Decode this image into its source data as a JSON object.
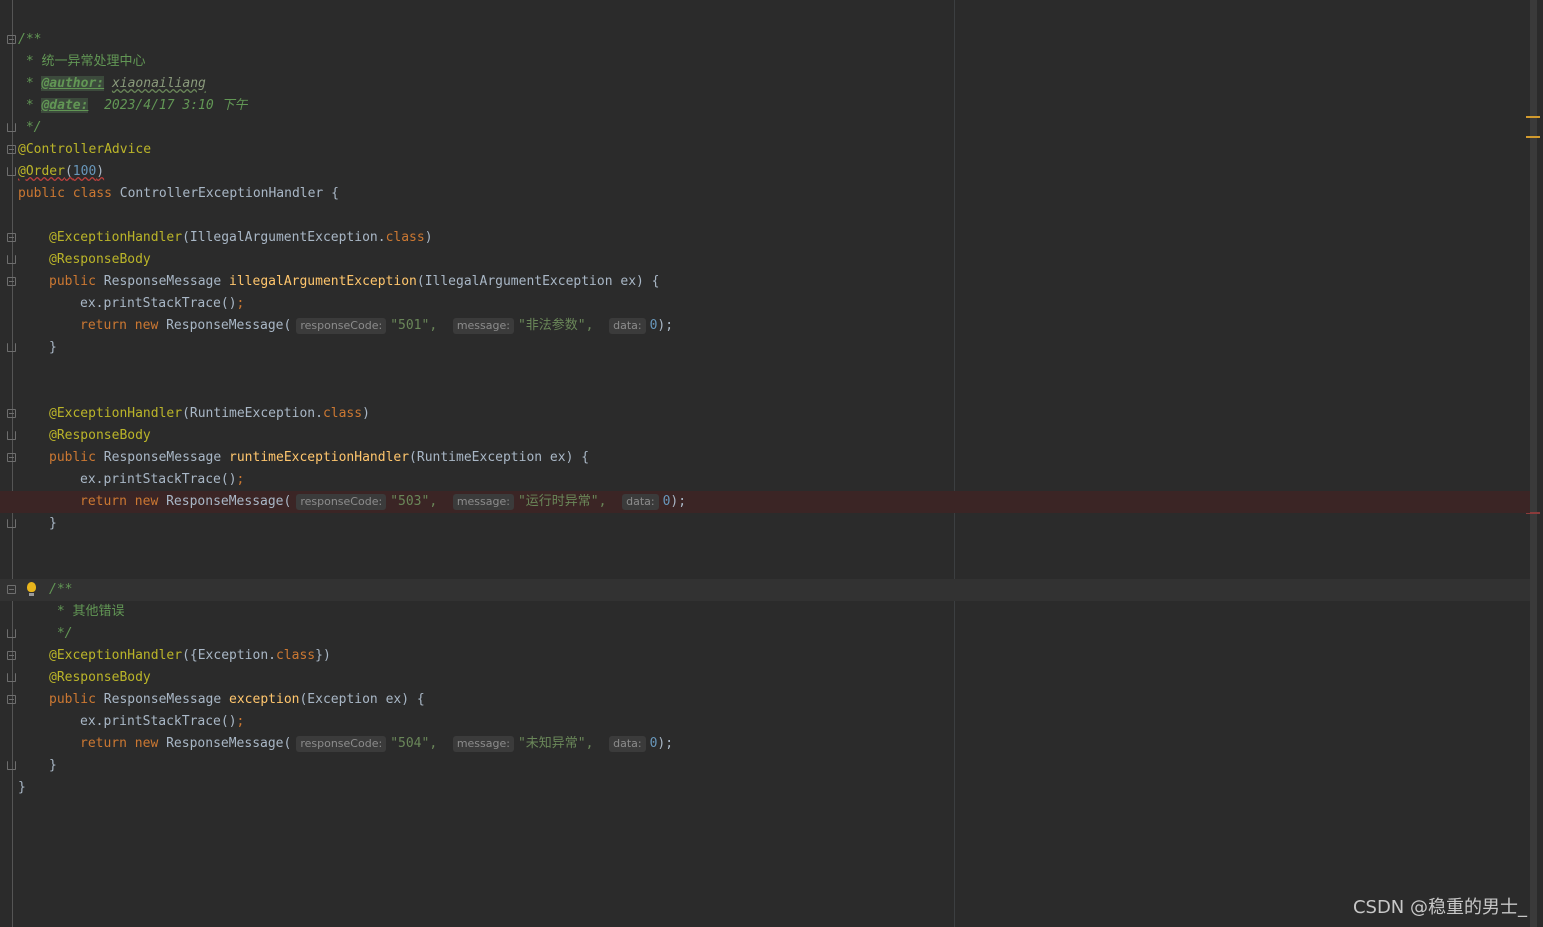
{
  "editor": {
    "colors": {
      "background": "#2b2b2b",
      "keyword": "#cc7832",
      "annotation": "#bbb529",
      "method": "#ffc66d",
      "number": "#6897bb",
      "string": "#6a8759",
      "comment": "#629755",
      "error_line": "#3b2525"
    },
    "icons": [
      "fold-marker-icon",
      "lightbulb-icon"
    ],
    "header_comment": {
      "open": "/**",
      "desc": " * 统一异常处理中心",
      "star": " * ",
      "author_tag": "@author:",
      "author_value": "xiaonailiang",
      "date_tag": "@date:",
      "date_value": "  2023/4/17 3:10 下午",
      "close": " */"
    },
    "class_decl": {
      "annotation1": "@ControllerAdvice",
      "annotation2": "@Order",
      "order_value": "100",
      "kw_public": "public",
      "kw_class": "class",
      "class_name": "ControllerExceptionHandler",
      "open_brace": " {",
      "close_brace": "}"
    },
    "common": {
      "annotation_handler": "@ExceptionHandler",
      "annotation_body": "@ResponseBody",
      "kw_public": "public",
      "return_type": "ResponseMessage",
      "print_stmt": "ex.printStackTrace()",
      "semicolon": ";",
      "kw_return": "return",
      "kw_new": "new",
      "ctor": "ResponseMessage(",
      "hint_code": "responseCode:",
      "hint_message": "message:",
      "hint_data": "data:",
      "data_value": "0",
      "close_call": ");",
      "close_brace": "}",
      "kw_class": "class"
    },
    "methods": [
      {
        "handler_prefix": "(IllegalArgumentException.",
        "handler_suffix": ")",
        "name": "illegalArgumentException",
        "params": "(IllegalArgumentException ex) {",
        "code": "\"501\",",
        "message": "\"非法参数\","
      },
      {
        "handler_prefix": "(RuntimeException.",
        "handler_suffix": ")",
        "name": "runtimeExceptionHandler",
        "params": "(RuntimeException ex) {",
        "code": "\"503\",",
        "message": "\"运行时异常\","
      },
      {
        "doc_open": "/**",
        "doc_desc": " * 其他错误",
        "doc_close": " */",
        "handler_prefix": "({Exception.",
        "handler_suffix": "})",
        "name": "exception",
        "params": "(Exception ex) {",
        "code": "\"504\",",
        "message": "\"未知异常\","
      }
    ]
  },
  "watermark": "CSDN @稳重的男士_"
}
